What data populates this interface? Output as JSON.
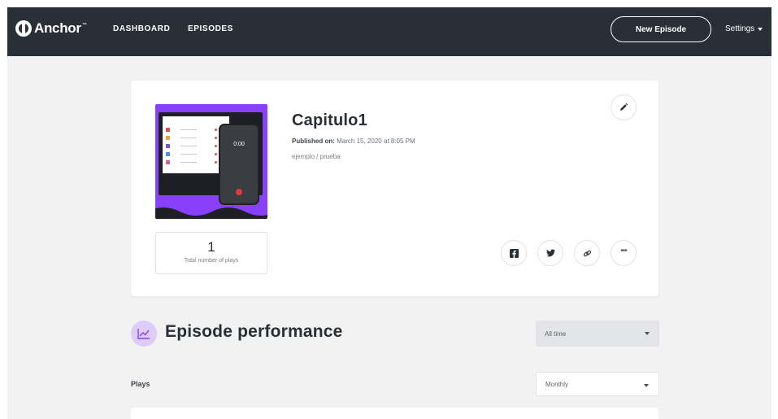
{
  "nav": {
    "brand": "Anchor",
    "links": [
      "DASHBOARD",
      "EPISODES"
    ],
    "new_episode_label": "New Episode",
    "settings_label": "Settings"
  },
  "episode": {
    "title": "Capitulo1",
    "published_label": "Published on:",
    "published_date": "March 15, 2020 at 8:05 PM",
    "description": "ejemplo / prueba",
    "plays_count": "1",
    "plays_label": "Total number of plays",
    "thumbnail_time": "0:00"
  },
  "share": {
    "facebook_icon": "facebook-icon",
    "twitter_icon": "twitter-icon",
    "link_icon": "link-icon",
    "more_icon": "more-icon"
  },
  "performance": {
    "title": "Episode performance",
    "range_value": "All time",
    "plays_heading": "Plays",
    "interval_value": "Monthly"
  },
  "colors": {
    "nav_bg": "#292f36",
    "accent_purple": "#8940fa",
    "page_bg": "#f2f2f3"
  }
}
